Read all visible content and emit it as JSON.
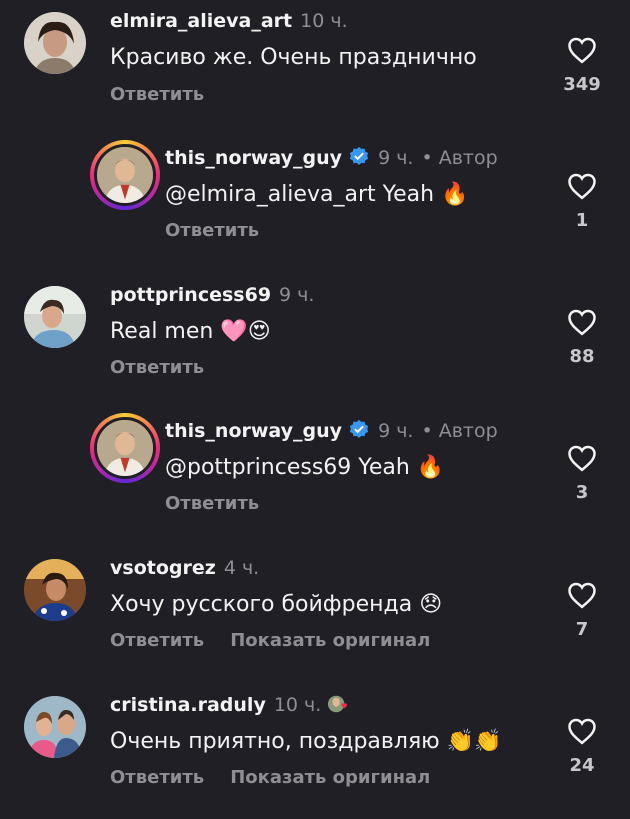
{
  "comments": [
    {
      "username": "elmira_alieva_art",
      "time": "10 ч.",
      "text": "Красиво же. Очень празднично",
      "reply": "Ответить",
      "likes": "349"
    },
    {
      "username": "this_norway_guy",
      "time": "9 ч.",
      "author": "• Автор",
      "mention": "@elmira_alieva_art",
      "text": "Yeah",
      "emoji": "🔥",
      "reply": "Ответить",
      "likes": "1"
    },
    {
      "username": "pottprincess69",
      "time": "9 ч.",
      "text": "Real men",
      "emoji": "🩷😍",
      "reply": "Ответить",
      "likes": "88"
    },
    {
      "username": "this_norway_guy",
      "time": "9 ч.",
      "author": "• Автор",
      "mention": "@pottprincess69",
      "text": "Yeah",
      "emoji": "🔥",
      "reply": "Ответить",
      "likes": "3"
    },
    {
      "username": "vsotogrez",
      "time": "4 ч.",
      "text": "Хочу русского бойфренда",
      "emoji": "😞",
      "reply": "Ответить",
      "show_original": "Показать оригинал",
      "likes": "7"
    },
    {
      "username": "cristina.raduly",
      "time": "10 ч.",
      "text": "Очень приятно, поздравляю",
      "emoji": "👏👏",
      "reply": "Ответить",
      "show_original": "Показать оригинал",
      "likes": "24"
    }
  ],
  "colors": {
    "background": "#1f1f25",
    "muted": "#8e8e93",
    "verified": "#3897f0"
  },
  "icons": {
    "like": "heart-outline-icon",
    "verified": "verified-badge-icon"
  }
}
